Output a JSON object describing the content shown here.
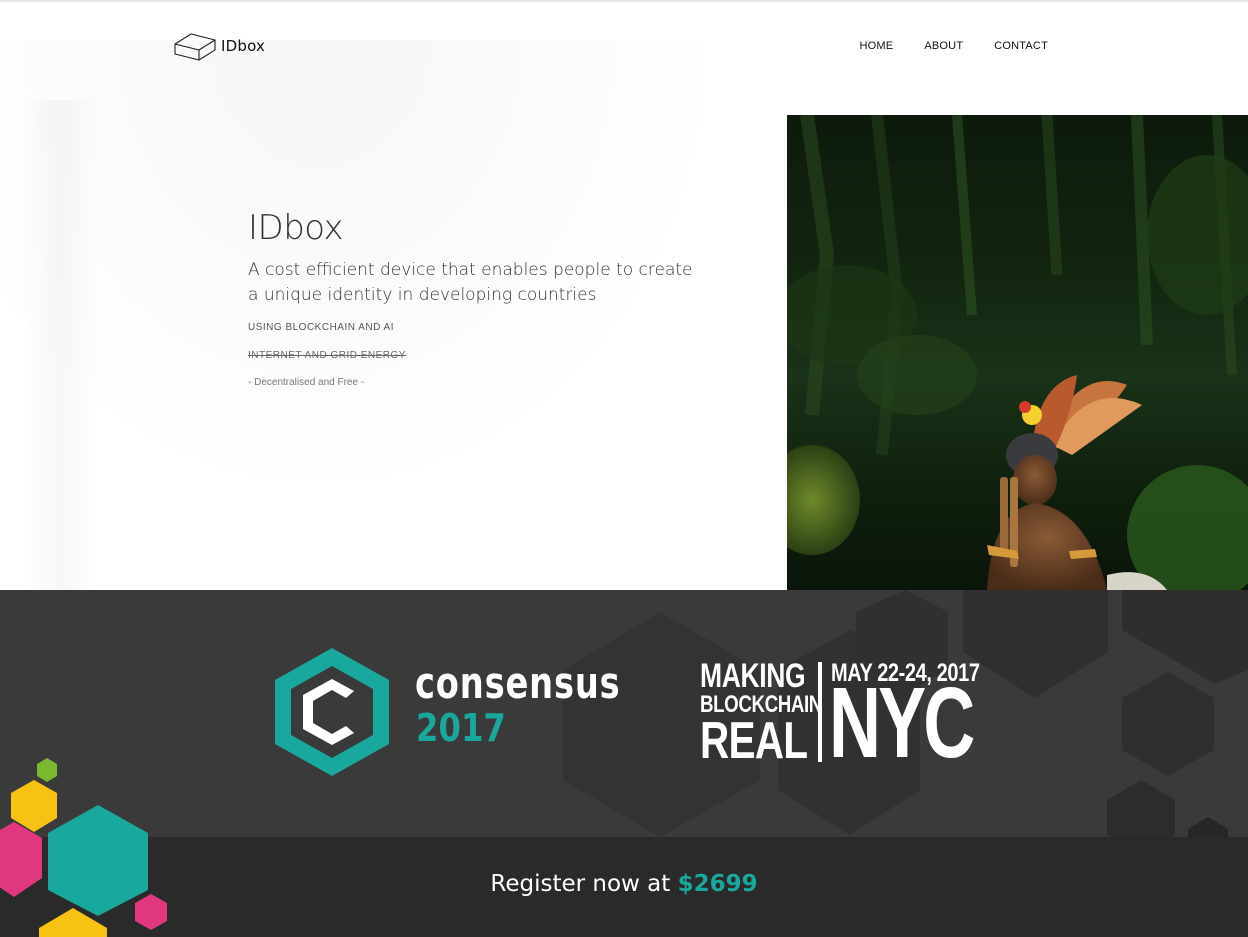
{
  "header": {
    "logo_text": "IDbox",
    "nav": [
      "HOME",
      "ABOUT",
      "CONTACT"
    ]
  },
  "hero": {
    "title": "IDbox",
    "subtitle": "A cost efficient device that enables people to create a unique identity in developing countries",
    "tag_1": "USING BLOCKCHAIN AND AI",
    "tag_2": "INTERNET AND GRID ENERGY",
    "tag_3": "- Decentralised and Free -"
  },
  "banner": {
    "brand": "consensus",
    "year": "2017",
    "tagline_1": "MAKING",
    "tagline_2": "BLOCKCHAIN",
    "tagline_3": "REAL",
    "dates": "MAY 22-24, 2017",
    "city": "NYC",
    "register_text": "Register now at",
    "register_price": "$2699"
  },
  "colors": {
    "accent_teal": "#19a89d",
    "banner_bg": "#3a3a3a",
    "banner_bottom_bg": "#2a2a2a",
    "hex_yellow": "#f7c214",
    "hex_pink": "#e0377f",
    "hex_green": "#7cb82f"
  }
}
